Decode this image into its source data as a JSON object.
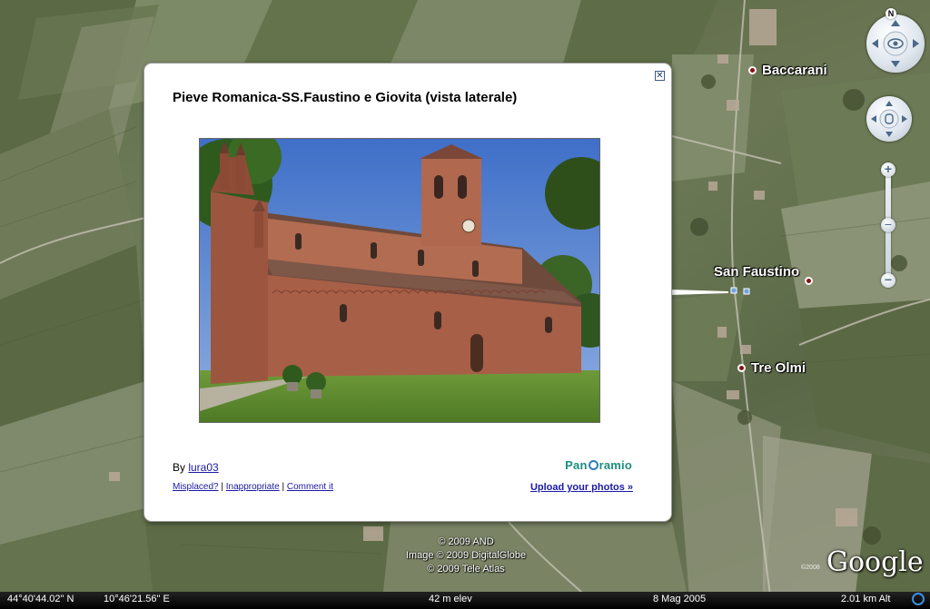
{
  "places": [
    {
      "name": "Baccarani"
    },
    {
      "name": "San Faustino"
    },
    {
      "name": "Tre Olmi"
    }
  ],
  "navigation": {
    "north_label": "N",
    "zoom_in_label": "+",
    "zoom_out_label": "−",
    "zoom_slider_label": "−"
  },
  "balloon": {
    "title": "Pieve Romanica-SS.Faustino e Giovita (vista laterale)",
    "close_label": "✕",
    "author_prefix": "By ",
    "author": "lura03",
    "link_misplaced": "Misplaced?",
    "link_inappropriate": "Inappropriate",
    "link_comment": "Comment it",
    "separator": " | ",
    "upload_label": "Upload your photos »",
    "logo_left": "Pan",
    "logo_right": "ramio"
  },
  "copyright": {
    "line1": "© 2009 AND",
    "line2": "Image © 2009 DigitalGlobe",
    "line3": "© 2009 Tele Atlas"
  },
  "google_logo": {
    "text": "Google",
    "year": "©2008"
  },
  "statusbar": {
    "latitude": "44°40'44.02\" N",
    "longitude": "10°46'21.56\" E",
    "elevation": "42 m elev",
    "date": "8 Mag 2005",
    "eye_alt": "2.01 km Alt"
  },
  "colors": {
    "place_dot": "#8a1010",
    "link": "#1a1aa6",
    "panoramio": "#1c8f7d"
  }
}
